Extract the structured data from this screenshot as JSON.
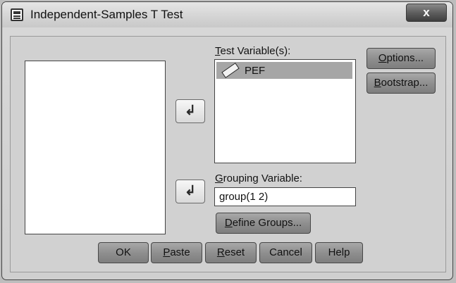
{
  "window": {
    "title": "Independent-Samples T Test",
    "close_label": "x"
  },
  "left_panel": {
    "source_items": []
  },
  "arrows": {
    "move_to_test_glyph": "↲",
    "move_to_grouping_glyph": "↲"
  },
  "test_variables": {
    "label_prefix": "",
    "label_mnemonic": "T",
    "label_rest": "est Variable(s):",
    "items": [
      {
        "label": "PEF",
        "icon": "scale-ruler-icon"
      }
    ]
  },
  "grouping": {
    "label_mnemonic": "G",
    "label_rest": "rouping Variable:",
    "value": "group(1 2)"
  },
  "side_buttons": {
    "options_mnemonic": "O",
    "options_rest": "ptions...",
    "bootstrap_mnemonic": "B",
    "bootstrap_rest": "ootstrap..."
  },
  "define_groups": {
    "mnemonic": "D",
    "rest": "efine Groups..."
  },
  "bottom_buttons": {
    "ok": "OK",
    "paste_mnemonic": "P",
    "paste_rest": "aste",
    "reset_mnemonic": "R",
    "reset_rest": "eset",
    "cancel": "Cancel",
    "help": "Help"
  },
  "colors": {
    "selected_row": "#a6a6a6",
    "button_face": "#8f8f8f"
  }
}
